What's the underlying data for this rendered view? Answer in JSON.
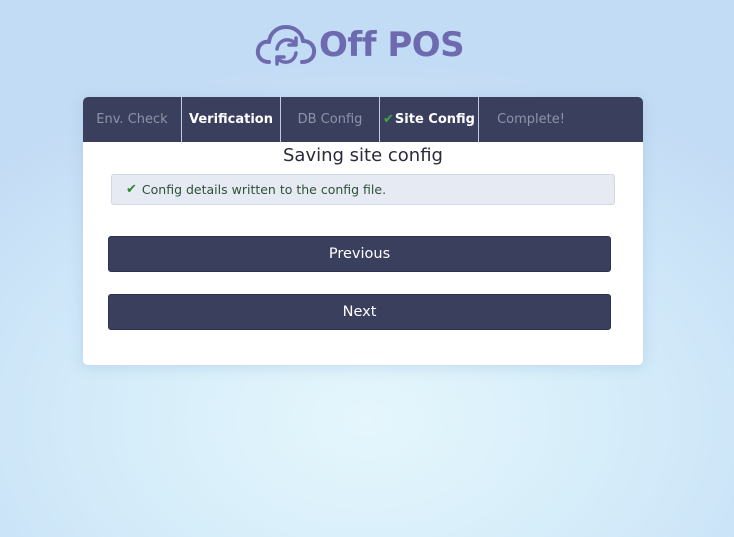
{
  "logo": {
    "text": "Off POS",
    "icon": "cloud-sync-icon",
    "color": "#6e6aaf"
  },
  "tabs": [
    {
      "label": "Env. Check",
      "state": "inactive"
    },
    {
      "label": "Verification",
      "state": "done"
    },
    {
      "label": "DB Config",
      "state": "inactive"
    },
    {
      "label": "Site Config",
      "state": "active",
      "check": "✔"
    },
    {
      "label": "Complete!",
      "state": "inactive"
    }
  ],
  "main": {
    "title": "Saving site config",
    "alert": {
      "icon": "check-icon",
      "check": "✔",
      "message": "Config details written to the config file."
    },
    "previous_label": "Previous",
    "next_label": "Next"
  },
  "colors": {
    "tab_bar": "#3b3f5e",
    "button": "#3b3f5e",
    "success": "#2a8a2a",
    "brand": "#6e6aaf"
  }
}
